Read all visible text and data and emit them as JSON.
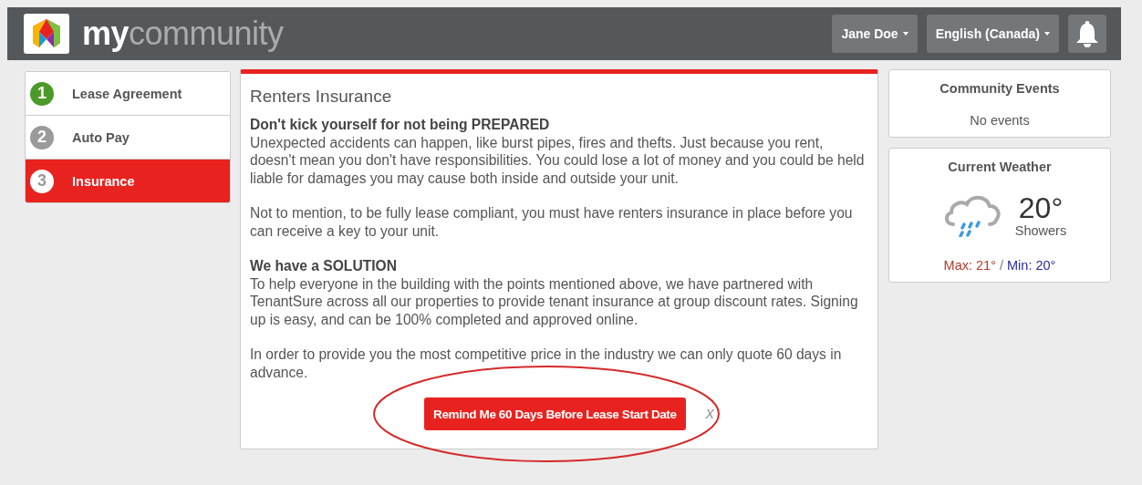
{
  "header": {
    "logo_text_bold": "my",
    "logo_text_light": "community",
    "user_menu": "Jane Doe",
    "language_menu": "English (Canada)"
  },
  "steps": [
    {
      "number": "1",
      "label": "Lease Agreement",
      "kind": "complete",
      "selected": false
    },
    {
      "number": "2",
      "label": "Auto Pay",
      "kind": "incomplete",
      "selected": false
    },
    {
      "number": "3",
      "label": "Insurance",
      "kind": "incomplete",
      "selected": true
    }
  ],
  "main": {
    "title": "Renters Insurance",
    "sections": [
      {
        "heading": "Don't kick yourself for not being PREPARED",
        "body": "Unexpected accidents can happen, like burst pipes, fires and thefts. Just because you rent, doesn't mean you don't have responsibilities. You could lose a lot of money and you could be held liable for damages you may cause both inside and outside your unit."
      },
      {
        "body": "Not to mention, to be fully lease compliant, you must have renters insurance in place before you can receive a key to your unit."
      },
      {
        "heading": "We have a SOLUTION",
        "body": "To help everyone in the building with the points mentioned above, we have partnered with TenantSure across all our properties to provide tenant insurance at group discount rates. Signing up is easy, and can be 100% completed and approved online."
      },
      {
        "body": "In order to provide you the most competitive price in the industry we can only quote 60 days in advance."
      }
    ],
    "remind_button": "Remind Me 60 Days Before Lease Start Date",
    "dismiss": "X",
    "highlighted": true
  },
  "events": {
    "title": "Community Events",
    "message": "No events"
  },
  "weather": {
    "title": "Current Weather",
    "temperature": "20°",
    "condition": "Showers",
    "max": "Max: 21°",
    "separator": "/",
    "min": "Min: 20°"
  }
}
